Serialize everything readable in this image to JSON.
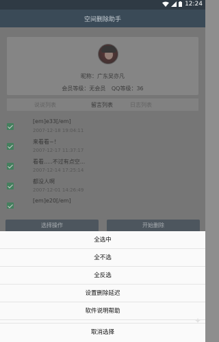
{
  "status_bar": {
    "time": "12:24"
  },
  "app_bar": {
    "title": "空间删除助手"
  },
  "profile": {
    "nickname_line": "昵称：广东吴亦凡",
    "member_level": "会员等级：无会员",
    "qq_level": "QQ等级：36"
  },
  "tabs": [
    {
      "label": "说说列表",
      "active": false
    },
    {
      "label": "留言列表",
      "active": true
    },
    {
      "label": "日志列表",
      "active": false
    }
  ],
  "messages": [
    {
      "text": "[em]e33[/em]",
      "time": "2007-12-18 19:04:11",
      "checked": true
    },
    {
      "text": "来看看~！",
      "time": "2007-12-17 11:37:17",
      "checked": true
    },
    {
      "text": "看看.....不过有点空...",
      "time": "2007-12-14 17:25:14",
      "checked": true
    },
    {
      "text": "都没人啊",
      "time": "2007-12-01 14:26:49",
      "checked": true
    },
    {
      "text": "[em]e20[/em]",
      "time": "",
      "checked": true
    }
  ],
  "actions": {
    "select_label": "选择操作",
    "start_label": "开始删除"
  },
  "sheet": {
    "items": [
      "全选中",
      "全不选",
      "全反选",
      "设置删除延迟",
      "软件说明帮助"
    ],
    "cancel": "取消选择"
  },
  "colors": {
    "app_bar": "#3a4a57",
    "checkbox": "#2e8b57",
    "sheet_bg": "#fafafa"
  }
}
